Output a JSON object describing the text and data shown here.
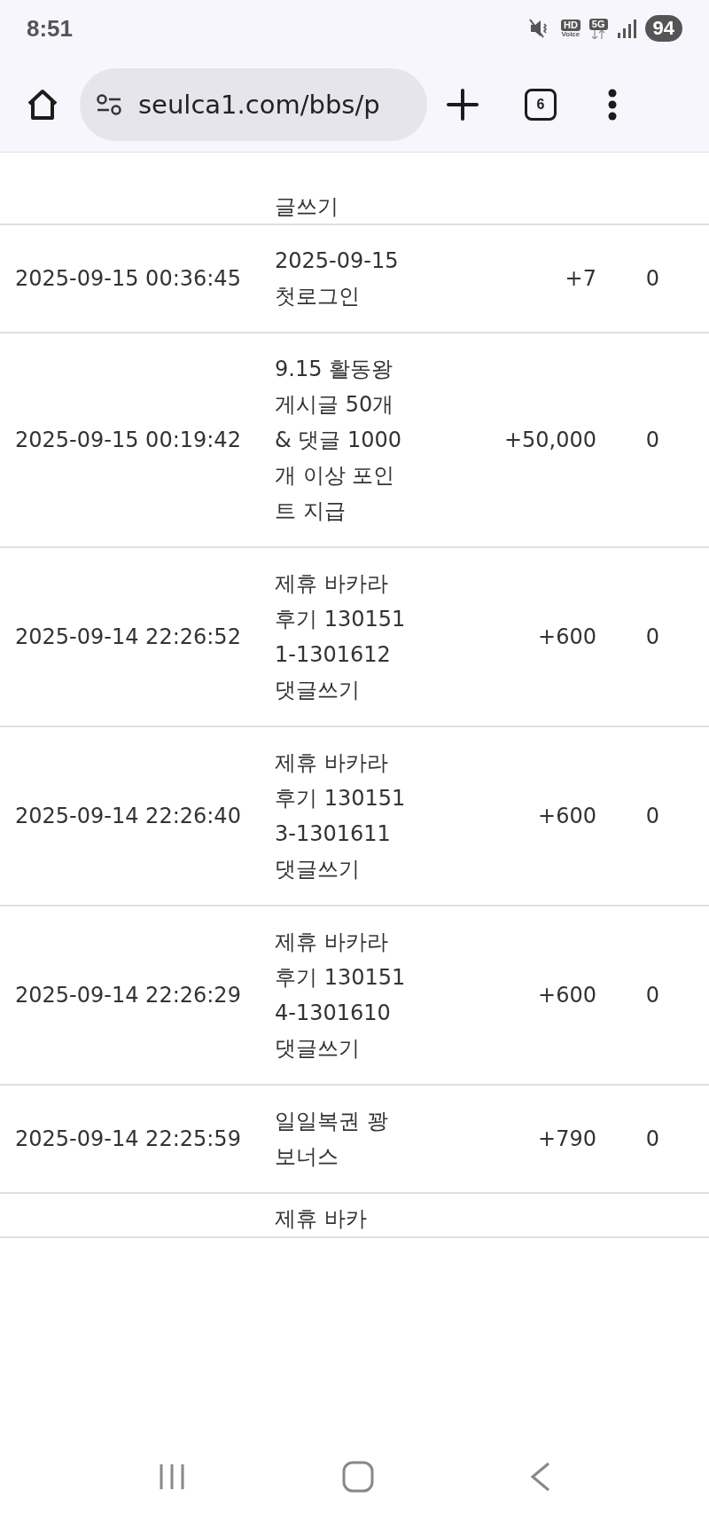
{
  "status_bar": {
    "time": "8:51",
    "hd": "HD",
    "voice": "Voice",
    "network": "5G",
    "battery": "94"
  },
  "browser": {
    "url": "seulca1.com/bbs/p",
    "tab_count": "6"
  },
  "rows": [
    {
      "date": "",
      "description": "글쓰기",
      "amount": "",
      "balance": ""
    },
    {
      "date": "2025-09-15 00:36:45",
      "description": "2025-09-15 첫로그인",
      "amount": "+7",
      "balance": "0"
    },
    {
      "date": "2025-09-15 00:19:42",
      "description": "9.15 활동왕 게시글 50개 & 댓글 1000개 이상 포인트 지급",
      "amount": "+50,000",
      "balance": "0"
    },
    {
      "date": "2025-09-14 22:26:52",
      "description": "제휴 바카라후기 1301511-1301612 댓글쓰기",
      "amount": "+600",
      "balance": "0"
    },
    {
      "date": "2025-09-14 22:26:40",
      "description": "제휴 바카라후기 1301513-1301611 댓글쓰기",
      "amount": "+600",
      "balance": "0"
    },
    {
      "date": "2025-09-14 22:26:29",
      "description": "제휴 바카라후기 1301514-1301610 댓글쓰기",
      "amount": "+600",
      "balance": "0"
    },
    {
      "date": "2025-09-14 22:25:59",
      "description": "일일복권 꽝 보너스",
      "amount": "+790",
      "balance": "0"
    },
    {
      "date": "",
      "description": "제휴 바카",
      "amount": "",
      "balance": ""
    }
  ]
}
